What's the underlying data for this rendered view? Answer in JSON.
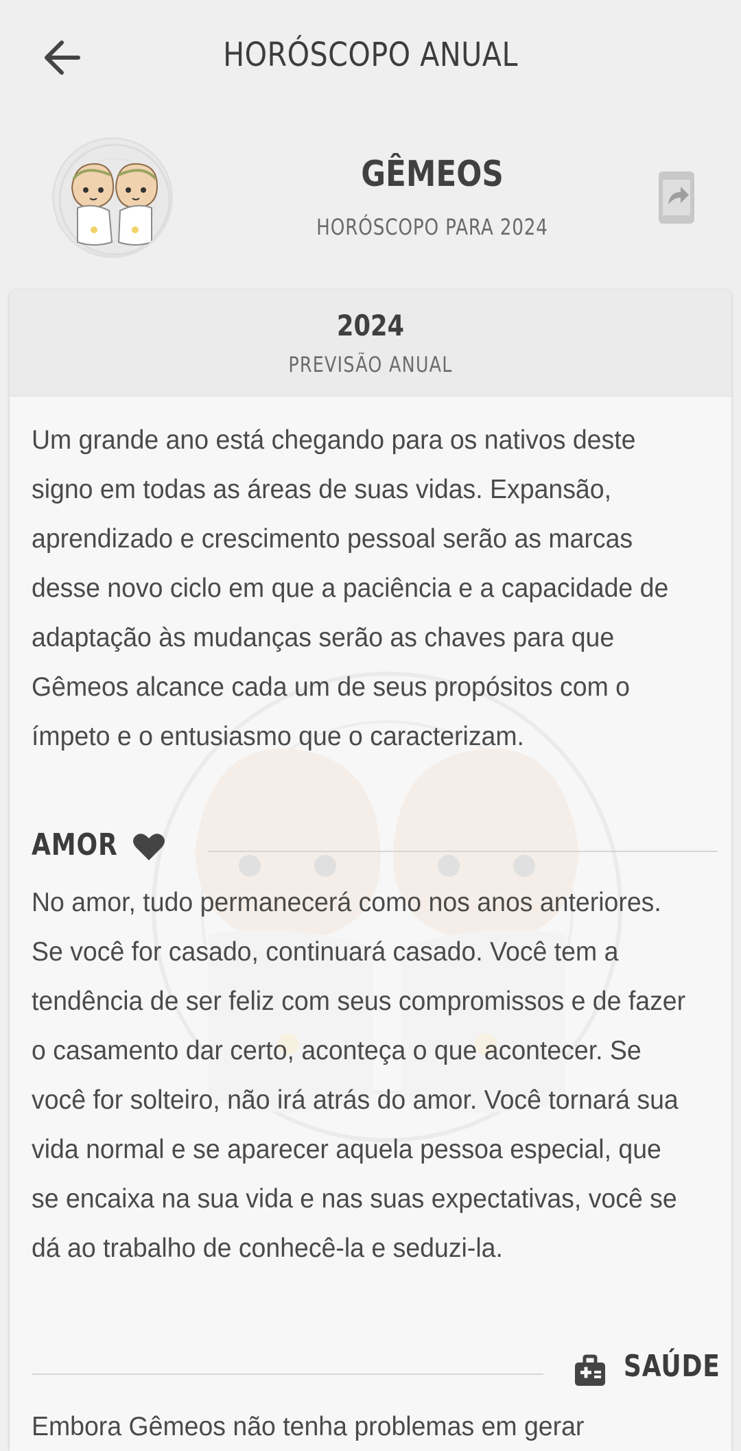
{
  "header": {
    "title": "HORÓSCOPO ANUAL",
    "back_icon": "arrow-left-icon"
  },
  "sign": {
    "name": "GÊMEOS",
    "subtitle": "HORÓSCOPO PARA 2024",
    "avatar": "gemini-twins-avatar",
    "share_icon": "share-icon"
  },
  "card": {
    "year": "2024",
    "label": "PREVISÃO ANUAL",
    "intro": "Um grande ano está chegando para os nativos deste signo em todas as áreas de suas vidas. Expansão, aprendizado e crescimento pessoal serão as marcas desse novo ciclo em que a paciência e a capacidade de adaptação às mudanças serão as chaves para que Gêmeos alcance cada um de seus propósitos com o ímpeto e o entusiasmo que o caracterizam.",
    "sections": [
      {
        "title": "AMOR",
        "icon": "heart-icon",
        "text": "No amor, tudo permanecerá como nos anos anteriores. Se você for casado, continuará casado. Você tem a tendência de ser feliz com seus compromissos e de fazer o casamento dar certo, aconteça o que acontecer. Se você for solteiro, não irá atrás do amor. Você tornará sua vida normal e se aparecer aquela pessoa especial, que se encaixa na sua vida e nas suas expectativas, você se dá ao trabalho de conhecê-la e seduzi-la."
      },
      {
        "title": "SAÚDE",
        "icon": "medical-kit-icon",
        "text": "Embora Gêmeos não tenha problemas em gerar"
      }
    ]
  },
  "colors": {
    "background": "#efefef",
    "card": "#f7f7f7",
    "card_header": "#ebebeb",
    "text": "#4a4a4a",
    "title": "#3c3c3c"
  }
}
